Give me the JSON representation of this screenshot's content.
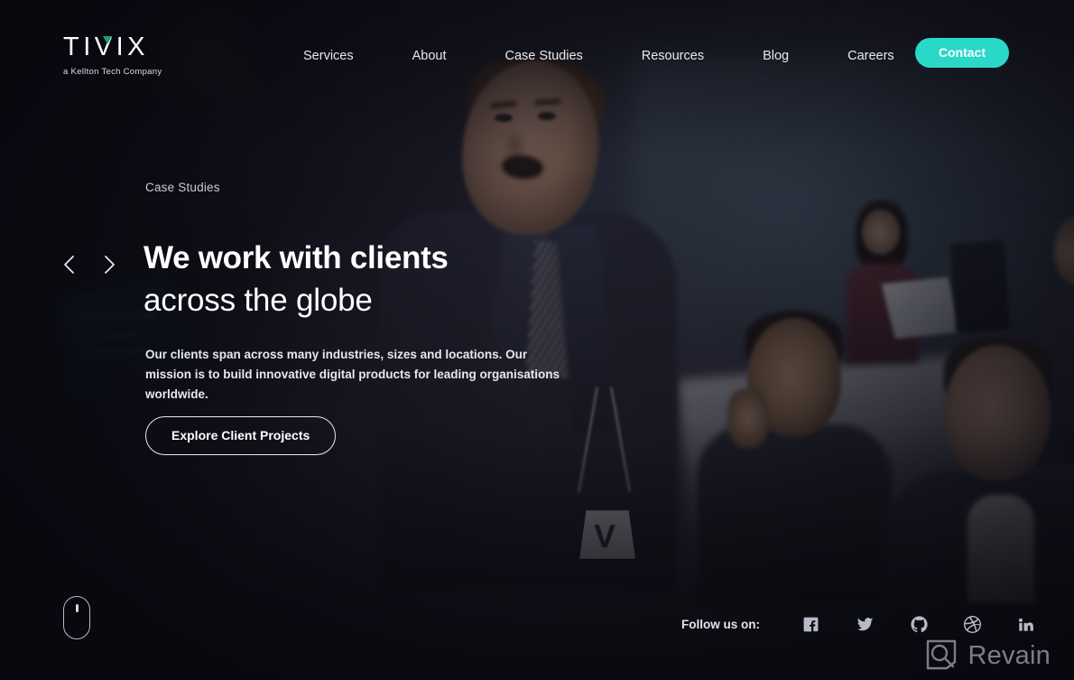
{
  "brand": {
    "logo_text": "TIVIX",
    "logo_tagline": "a Kellton Tech Company",
    "accent_color": "#1f9d68",
    "cta_color": "#2ad8c8"
  },
  "nav": {
    "items": [
      {
        "label": "Services"
      },
      {
        "label": "About"
      },
      {
        "label": "Case Studies"
      },
      {
        "label": "Resources"
      },
      {
        "label": "Blog"
      },
      {
        "label": "Careers"
      }
    ],
    "contact_label": "Contact"
  },
  "hero": {
    "eyebrow": "Case Studies",
    "title_line1": "We work with clients",
    "title_line2": "across the globe",
    "body": "Our clients span across many industries, sizes and locations. Our mission is to build innovative digital products for leading organisations worldwide.",
    "cta_label": "Explore Client Projects",
    "prev_icon": "chevron-left-icon",
    "next_icon": "chevron-right-icon",
    "scroll_icon": "scroll-mouse-icon"
  },
  "footer": {
    "follow_label": "Follow us on:",
    "social": [
      {
        "name": "facebook-icon"
      },
      {
        "name": "twitter-icon"
      },
      {
        "name": "github-icon"
      },
      {
        "name": "dribbble-icon"
      },
      {
        "name": "linkedin-icon"
      }
    ]
  },
  "watermark": {
    "text": "Revain",
    "icon": "revain-magnifier-icon"
  }
}
